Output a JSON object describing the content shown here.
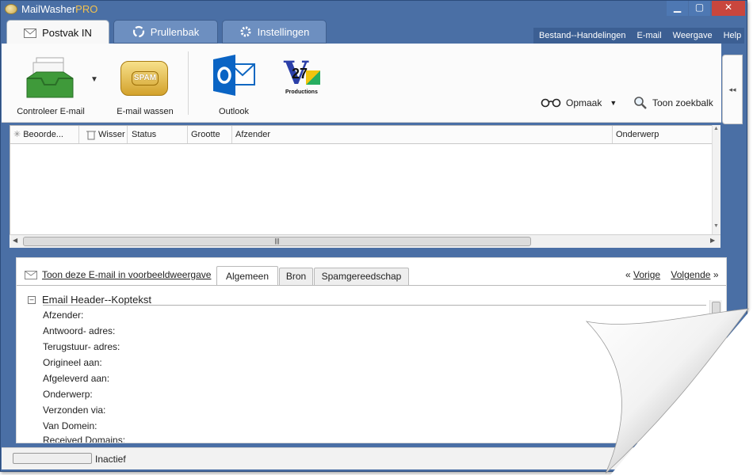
{
  "window": {
    "title_main": "MailWasher",
    "title_suffix": "PRO",
    "minimize_label": "▁",
    "maximize_label": "▢",
    "close_label": "✕"
  },
  "tabs": [
    {
      "label": "Postvak IN",
      "icon": "envelope-icon",
      "active": true
    },
    {
      "label": "Prullenbak",
      "icon": "recycle-icon",
      "active": false
    },
    {
      "label": "Instellingen",
      "icon": "gear-icon",
      "active": false
    }
  ],
  "menu": [
    "Bestand--Handelingen",
    "E-mail",
    "Weergave",
    "Help"
  ],
  "ribbon": {
    "check_mail": "Controleer E-mail",
    "wash_mail": "E-mail wassen",
    "spam_badge": "SPAM",
    "outlook": "Outlook",
    "v27_text": "27",
    "v27_caption": "Productions",
    "opmaak": "Opmaak",
    "search_bar": "Toon zoekbalk",
    "collapse_glyph": "◂◂"
  },
  "list": {
    "columns": [
      "Beoorde...",
      "Wisser",
      "Status",
      "Grootte",
      "Afzender",
      "Onderwerp"
    ],
    "rows": []
  },
  "preview": {
    "link_text": "Toon deze E-mail in voorbeeldweergave",
    "tabs": [
      "Algemeen",
      "Bron",
      "Spamgereedschap"
    ],
    "active_tab": "Algemeen",
    "prev_prefix": "«",
    "prev": "Vorige",
    "next": "Volgende",
    "next_suffix": "»",
    "section_title": "Email Header--Koptekst",
    "fields": [
      "Afzender:",
      "Antwoord- adres:",
      "Terugstuur- adres:",
      "Origineel aan:",
      "Afgeleverd aan:",
      "Onderwerp:",
      "Verzonden via:",
      "Van Domein:",
      "Received Domains:"
    ]
  },
  "status": {
    "text": "Inactief"
  },
  "colors": {
    "frame": "#4a6fa5",
    "close": "#c9463d",
    "accent_pro": "#f2c14e"
  }
}
